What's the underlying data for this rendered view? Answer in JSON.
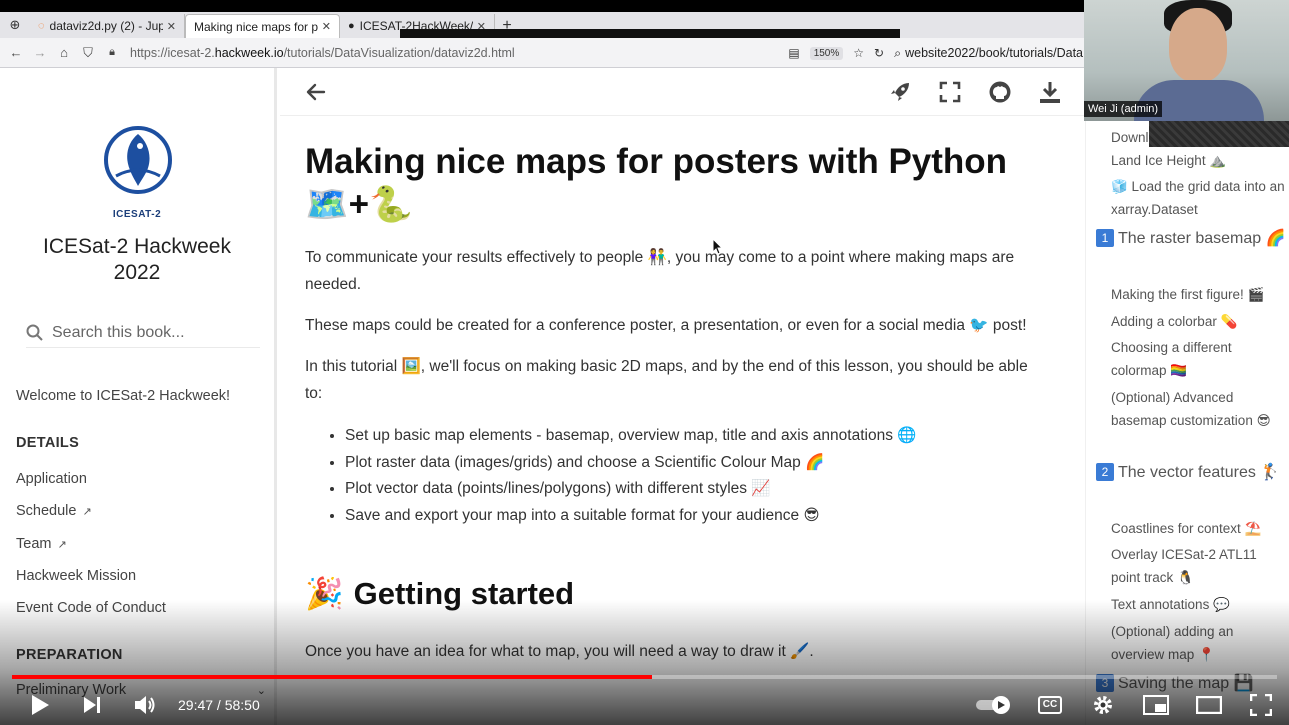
{
  "browser": {
    "tabs": [
      {
        "label": "dataviz2d.py (2) - Jupy",
        "icon": "jupyter-icon"
      },
      {
        "label": "Making nice maps for po",
        "icon": "none"
      },
      {
        "label": "ICESAT-2HackWeek/w",
        "icon": "github-icon"
      }
    ],
    "url_prefix": "https://icesat-2.",
    "url_domain": "hackweek.io",
    "url_path": "/tutorials/DataVisualization/dataviz2d.html",
    "zoom": "150%",
    "search_text": "website2022/book/tutorials/Data"
  },
  "sidebar": {
    "logo_caption": "ICESAT-2",
    "book_title": "ICESat-2 Hackweek 2022",
    "search_placeholder": "Search this book...",
    "welcome": "Welcome to ICESat-2 Hackweek!",
    "details_heading": "DETAILS",
    "details_items": [
      "Application",
      "Schedule",
      "Team",
      "Hackweek Mission",
      "Event Code of Conduct"
    ],
    "preparation_heading": "PREPARATION",
    "preparation_first": "Preliminary Work"
  },
  "main": {
    "title": "Making nice maps for posters with Python 🗺️+🐍",
    "p1": "To communicate your results effectively to people 👫, you may come to a point where making maps are needed.",
    "p2": "These maps could be created for a conference poster, a presentation, or even for a social media 🐦 post!",
    "p3": "In this tutorial 🖼️, we'll focus on making basic 2D maps, and by the end of this lesson, you should be able to:",
    "bullets": [
      "Set up basic map elements - basemap, overview map, title and axis annotations 🌐",
      "Plot raster data (images/grids) and choose a Scientific Colour Map 🌈",
      "Plot vector data (points/lines/polygons) with different styles 📈",
      "Save and export your map into a suitable format for your audience 😎"
    ],
    "section_emoji": "🎉",
    "section_title": "Getting started",
    "p4": "Once you have an idea for what to map, you will need a way to draw it 🖌️."
  },
  "toc": {
    "items": [
      {
        "text": "Downl",
        "level": 2
      },
      {
        "text": "Land Ice Height ⛰️",
        "level": 2
      },
      {
        "text": "🧊 Load the grid data into an xarray.Dataset",
        "level": 2
      },
      {
        "num": "1",
        "text": "The raster basemap 🌈",
        "level": 1
      },
      {
        "text": "Making the first figure! 🎬",
        "level": 2
      },
      {
        "text": "Adding a colorbar 💊",
        "level": 2
      },
      {
        "text": "Choosing a different colormap 🏳️‍🌈",
        "level": 2
      },
      {
        "text": "(Optional) Advanced basemap customization 😎",
        "level": 2
      },
      {
        "num": "2",
        "text": "The vector features 🏌️",
        "level": 1
      },
      {
        "text": "Coastlines for context ⛱️",
        "level": 2
      },
      {
        "text": "Overlay ICESat-2 ATL11 point track 🐧",
        "level": 2
      },
      {
        "text": "Text annotations 💬",
        "level": 2
      },
      {
        "text": "(Optional) adding an overview map 📍",
        "level": 2
      },
      {
        "num": "3",
        "text": "Saving the map 💾",
        "level": 1
      }
    ]
  },
  "webcam": {
    "name": "Wei Ji (admin)"
  },
  "player": {
    "current_time": "29:47",
    "duration": "58:50",
    "progress_fraction": 0.506,
    "cc_label": "CC"
  }
}
